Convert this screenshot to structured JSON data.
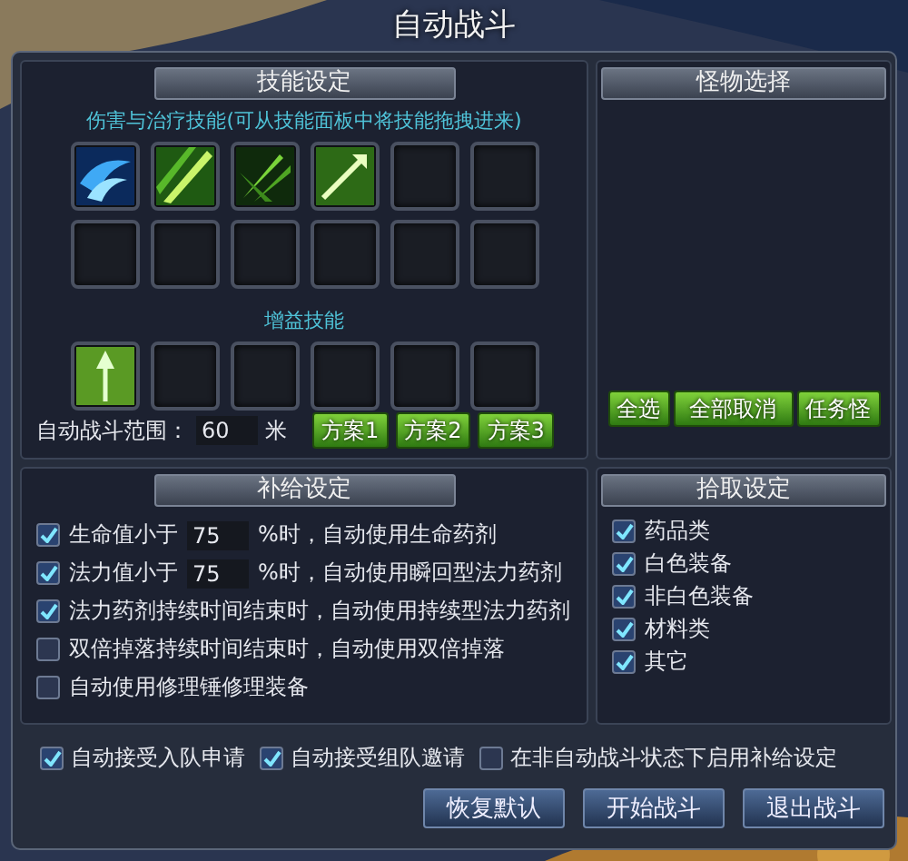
{
  "window": {
    "title": "自动战斗"
  },
  "skills": {
    "title": "技能设定",
    "attack_caption": "伤害与治疗技能(可从技能面板中将技能拖拽进来)",
    "attack_slots": [
      {
        "kind": "water"
      },
      {
        "kind": "slash"
      },
      {
        "kind": "leaves"
      },
      {
        "kind": "arrow"
      },
      {
        "kind": "empty"
      },
      {
        "kind": "empty"
      },
      {
        "kind": "empty"
      },
      {
        "kind": "empty"
      },
      {
        "kind": "empty"
      },
      {
        "kind": "empty"
      },
      {
        "kind": "empty"
      },
      {
        "kind": "empty"
      }
    ],
    "buff_caption": "增益技能",
    "buff_slots": [
      {
        "kind": "spear"
      },
      {
        "kind": "empty"
      },
      {
        "kind": "empty"
      },
      {
        "kind": "empty"
      },
      {
        "kind": "empty"
      },
      {
        "kind": "empty"
      }
    ],
    "range_label": "自动战斗范围：",
    "range_value": "60",
    "range_unit": "米",
    "plans": [
      "方案1",
      "方案2",
      "方案3"
    ]
  },
  "monsters": {
    "title": "怪物选择",
    "buttons": [
      "全选",
      "全部取消",
      "任务怪"
    ]
  },
  "supply": {
    "title": "补给设定",
    "rows": [
      {
        "kind": "threshold",
        "checked": true,
        "prefix": "生命值小于",
        "value": "75",
        "suffix": "%时，自动使用生命药剂"
      },
      {
        "kind": "threshold",
        "checked": true,
        "prefix": "法力值小于",
        "value": "75",
        "suffix": "%时，自动使用瞬回型法力药剂"
      },
      {
        "kind": "plain",
        "checked": true,
        "label": "法力药剂持续时间结束时，自动使用持续型法力药剂"
      },
      {
        "kind": "plain",
        "checked": false,
        "label": "双倍掉落持续时间结束时，自动使用双倍掉落"
      },
      {
        "kind": "plain",
        "checked": false,
        "label": "自动使用修理锤修理装备"
      }
    ]
  },
  "pickup": {
    "title": "拾取设定",
    "items": [
      {
        "label": "药品类",
        "checked": true
      },
      {
        "label": "白色装备",
        "checked": true
      },
      {
        "label": "非白色装备",
        "checked": true
      },
      {
        "label": "材料类",
        "checked": true
      },
      {
        "label": "其它",
        "checked": true
      }
    ]
  },
  "options": [
    {
      "label": "自动接受入队申请",
      "checked": true
    },
    {
      "label": "自动接受组队邀请",
      "checked": true
    },
    {
      "label": "在非自动战斗状态下启用补给设定",
      "checked": false
    }
  ],
  "buttons": [
    "恢复默认",
    "开始战斗",
    "退出战斗"
  ]
}
